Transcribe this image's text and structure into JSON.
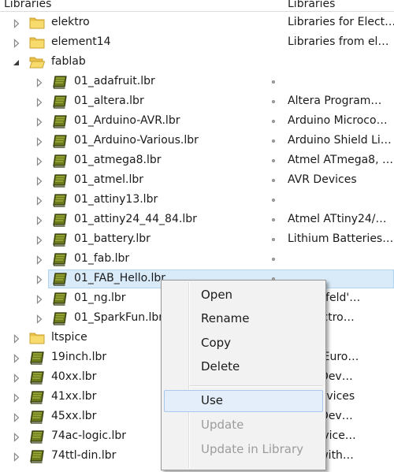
{
  "header": {
    "col_name": "Libraries",
    "col_desc": "Libraries"
  },
  "rows": [
    {
      "label": "elektro",
      "desc": "Libraries for Elect…",
      "icon": "folder-icon",
      "level": 0,
      "expanded": false,
      "dot": false,
      "selected": false
    },
    {
      "label": "element14",
      "desc": "Libraries from el…",
      "icon": "folder-icon",
      "level": 0,
      "expanded": false,
      "dot": false,
      "selected": false
    },
    {
      "label": "fablab",
      "desc": "",
      "icon": "open-folder-icon",
      "level": 0,
      "expanded": true,
      "dot": false,
      "selected": false
    },
    {
      "label": "01_adafruit.lbr",
      "desc": "",
      "icon": "library-book-icon",
      "level": 1,
      "expanded": false,
      "dot": true,
      "selected": false
    },
    {
      "label": "01_altera.lbr",
      "desc": "Altera Program…",
      "icon": "library-book-icon",
      "level": 1,
      "expanded": false,
      "dot": true,
      "selected": false
    },
    {
      "label": "01_Arduino-AVR.lbr",
      "desc": "Arduino Microco…",
      "icon": "library-book-icon",
      "level": 1,
      "expanded": false,
      "dot": true,
      "selected": false
    },
    {
      "label": "01_Arduino-Various.lbr",
      "desc": "Arduino Shield Li…",
      "icon": "library-book-icon",
      "level": 1,
      "expanded": false,
      "dot": true,
      "selected": false
    },
    {
      "label": "01_atmega8.lbr",
      "desc": "Atmel ATmega8, …",
      "icon": "library-book-icon",
      "level": 1,
      "expanded": false,
      "dot": true,
      "selected": false
    },
    {
      "label": "01_atmel.lbr",
      "desc": "AVR Devices",
      "icon": "library-book-icon",
      "level": 1,
      "expanded": false,
      "dot": true,
      "selected": false
    },
    {
      "label": "01_attiny13.lbr",
      "desc": "",
      "icon": "library-book-icon",
      "level": 1,
      "expanded": false,
      "dot": true,
      "selected": false
    },
    {
      "label": "01_attiny24_44_84.lbr",
      "desc": "Atmel ATtiny24/…",
      "icon": "library-book-icon",
      "level": 1,
      "expanded": false,
      "dot": true,
      "selected": false
    },
    {
      "label": "01_battery.lbr",
      "desc": "Lithium Batteries…",
      "icon": "library-book-icon",
      "level": 1,
      "expanded": false,
      "dot": true,
      "selected": false
    },
    {
      "label": "01_fab.lbr",
      "desc": "",
      "icon": "library-book-icon",
      "level": 1,
      "expanded": false,
      "dot": true,
      "selected": false
    },
    {
      "label": "01_FAB_Hello.lbr",
      "desc": "",
      "icon": "library-book-icon",
      "level": 1,
      "expanded": false,
      "dot": true,
      "selected": true
    },
    {
      "label": "01_ng.lbr",
      "desc": "ershenfeld'…",
      "icon": "library-book-icon",
      "level": 1,
      "expanded": false,
      "dot": true,
      "selected": false
    },
    {
      "label": "01_SparkFun.lbr",
      "desc": "un Electro…",
      "icon": "library-book-icon",
      "level": 1,
      "expanded": false,
      "dot": true,
      "selected": false
    },
    {
      "label": "ltspice",
      "desc": "",
      "icon": "folder-icon",
      "level": 0,
      "expanded": false,
      "dot": false,
      "selected": false
    },
    {
      "label": "19inch.lbr",
      "desc": "n Slot Euro…",
      "icon": "library-book-icon",
      "level": 0,
      "expanded": false,
      "dot": true,
      "selected": false
    },
    {
      "label": "40xx.lbr",
      "desc": "Logic Dev…",
      "icon": "library-book-icon",
      "level": 0,
      "expanded": false,
      "dot": true,
      "selected": false
    },
    {
      "label": "41xx.lbr",
      "desc": "ries Devices",
      "icon": "library-book-icon",
      "level": 0,
      "expanded": false,
      "dot": true,
      "selected": false
    },
    {
      "label": "45xx.lbr",
      "desc": "Logic Dev…",
      "icon": "library-book-icon",
      "level": 0,
      "expanded": false,
      "dot": true,
      "selected": false
    },
    {
      "label": "74ac-logic.lbr",
      "desc": "gic Device…",
      "icon": "library-book-icon",
      "level": 0,
      "expanded": false,
      "dot": true,
      "selected": false
    },
    {
      "label": "74ttl-din.lbr",
      "desc": "vices with…",
      "icon": "library-book-icon",
      "level": 0,
      "expanded": false,
      "dot": true,
      "selected": false
    }
  ],
  "context_menu": {
    "items": [
      {
        "label": "Open",
        "name": "menu-item-open",
        "disabled": false,
        "hot": false
      },
      {
        "label": "Rename",
        "name": "menu-item-rename",
        "disabled": false,
        "hot": false
      },
      {
        "label": "Copy",
        "name": "menu-item-copy",
        "disabled": false,
        "hot": false
      },
      {
        "label": "Delete",
        "name": "menu-item-delete",
        "disabled": false,
        "hot": false
      },
      {
        "label": "Use",
        "name": "menu-item-use",
        "disabled": false,
        "hot": true
      },
      {
        "label": "Update",
        "name": "menu-item-update",
        "disabled": true,
        "hot": false
      },
      {
        "label": "Update in Library",
        "name": "menu-item-update-in-library",
        "disabled": true,
        "hot": false
      }
    ]
  },
  "colors": {
    "selection_fill": "#d9ebf9",
    "selection_border": "#b2d4ee",
    "menu_bg": "#f2f2f2",
    "menu_hot_fill": "#e4eefa",
    "disabled_text": "#9c9c9c",
    "folder_yellow": "#f5d55b",
    "book_green": "#5b6b16"
  }
}
